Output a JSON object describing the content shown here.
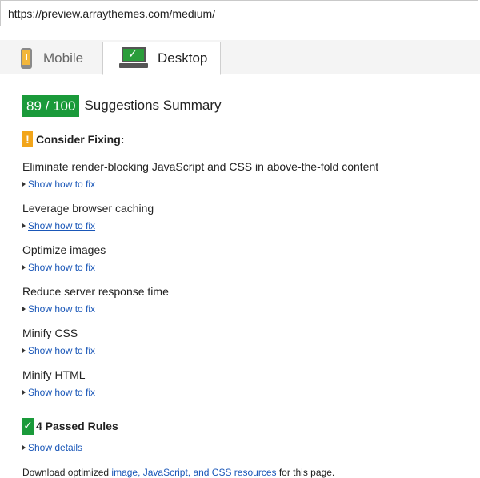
{
  "url": "https://preview.arraythemes.com/medium/",
  "tabs": [
    {
      "label": "Mobile",
      "icon": "mobile-warning-icon",
      "active": false
    },
    {
      "label": "Desktop",
      "icon": "desktop-check-icon",
      "active": true
    }
  ],
  "score": {
    "value": "89 / 100",
    "title": "Suggestions Summary",
    "color": "#1a9a3a"
  },
  "consider": {
    "title": "Consider Fixing:",
    "icon_glyph": "!",
    "color": "#f2a51a",
    "rules": [
      {
        "title": "Eliminate render-blocking JavaScript and CSS in above-the-fold content",
        "link": "Show how to fix"
      },
      {
        "title": "Leverage browser caching",
        "link": "Show how to fix"
      },
      {
        "title": "Optimize images",
        "link": "Show how to fix"
      },
      {
        "title": "Reduce server response time",
        "link": "Show how to fix"
      },
      {
        "title": "Minify CSS",
        "link": "Show how to fix"
      },
      {
        "title": "Minify HTML",
        "link": "Show how to fix"
      }
    ]
  },
  "passed": {
    "title": "4 Passed Rules",
    "icon_glyph": "✓",
    "details_link": "Show details"
  },
  "footer": {
    "prefix": "Download optimized ",
    "link": "image, JavaScript, and CSS resources",
    "suffix": " for this page."
  },
  "colors": {
    "link": "#1a57b8",
    "pass": "#1a9a3a",
    "warn": "#f2a51a"
  }
}
